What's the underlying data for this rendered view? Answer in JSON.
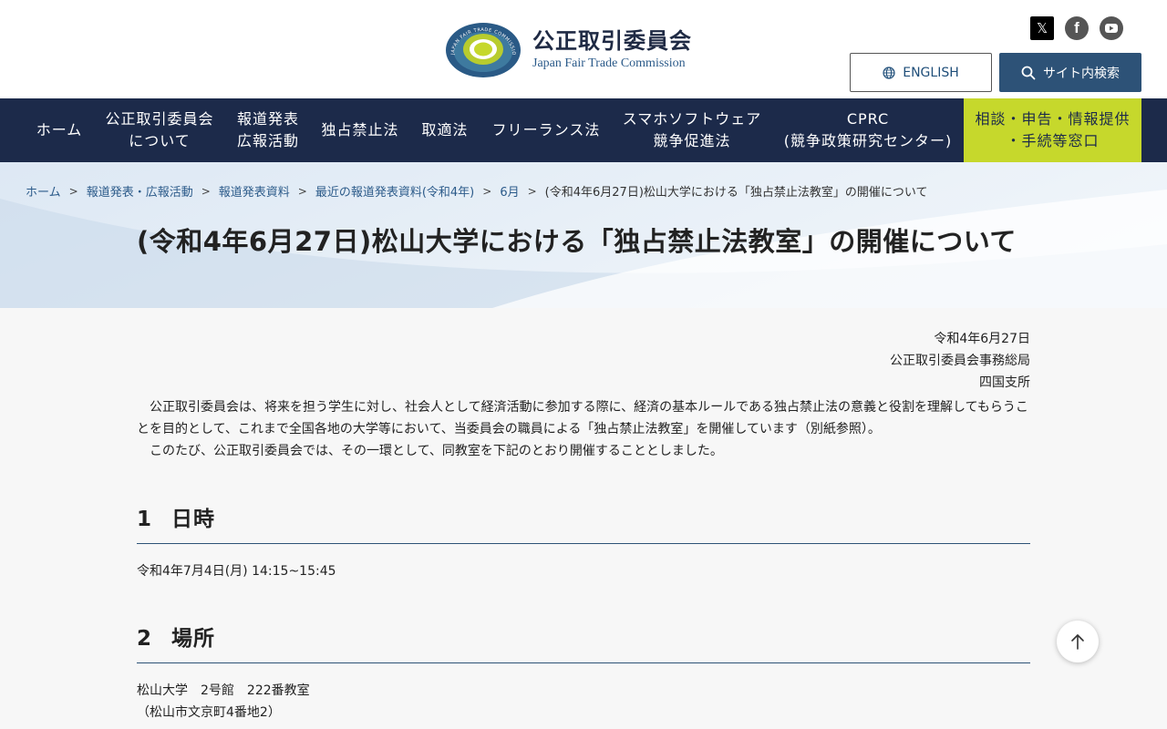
{
  "header": {
    "org_name_ja": "公正取引委員会",
    "org_name_en": "Japan Fair Trade Commission",
    "emblem_ring_text": "JAPAN FAIR TRADE COMMISSION",
    "social": [
      "x-icon",
      "facebook-icon",
      "youtube-icon"
    ],
    "english_label": "ENGLISH",
    "search_label": "サイト内検索"
  },
  "nav": {
    "items": [
      {
        "line1": "ホーム",
        "line2": ""
      },
      {
        "line1": "公正取引委員会",
        "line2": "について"
      },
      {
        "line1": "報道発表",
        "line2": "広報活動"
      },
      {
        "line1": "独占禁止法",
        "line2": ""
      },
      {
        "line1": "取適法",
        "line2": ""
      },
      {
        "line1": "フリーランス法",
        "line2": ""
      },
      {
        "line1": "スマホソフトウェア",
        "line2": "競争促進法"
      },
      {
        "line1": "CPRC",
        "line2": "(競争政策研究センター)"
      }
    ],
    "consult": {
      "line1": "相談・申告・情報提供",
      "line2": "・手続等窓口"
    }
  },
  "breadcrumb": {
    "items": [
      "ホーム",
      "報道発表・広報活動",
      "報道発表資料",
      "最近の報道発表資料(令和4年)",
      "6月"
    ],
    "current": "(令和4年6月27日)松山大学における「独占禁止法教室」の開催について"
  },
  "page": {
    "title": "(令和4年6月27日)松山大学における「独占禁止法教室」の開催について",
    "date": "令和4年6月27日",
    "issuer": "公正取引委員会事務総局",
    "branch": "四国支所",
    "paragraphs": [
      "公正取引委員会は、将来を担う学生に対し、社会人として経済活動に参加する際に、経済の基本ルールである独占禁止法の意義と役割を理解してもらうことを目的として、これまで全国各地の大学等において、当委員会の職員による「独占禁止法教室」を開催しています（別紙参照）。",
      "このたび、公正取引委員会では、その一環として、同教室を下記のとおり開催することとしました。"
    ],
    "sections": [
      {
        "num": "1",
        "title": "日時",
        "lines": [
          "令和4年7月4日(月) 14:15~15:45"
        ]
      },
      {
        "num": "2",
        "title": "場所",
        "lines": [
          "松山大学　2号館　222番教室",
          "（松山市文京町4番地2）"
        ]
      }
    ]
  },
  "colors": {
    "nav_bg": "#1c2a4a",
    "accent_green": "#c6d82c",
    "link": "#2c5b8a",
    "search_btn": "#2d5277"
  }
}
